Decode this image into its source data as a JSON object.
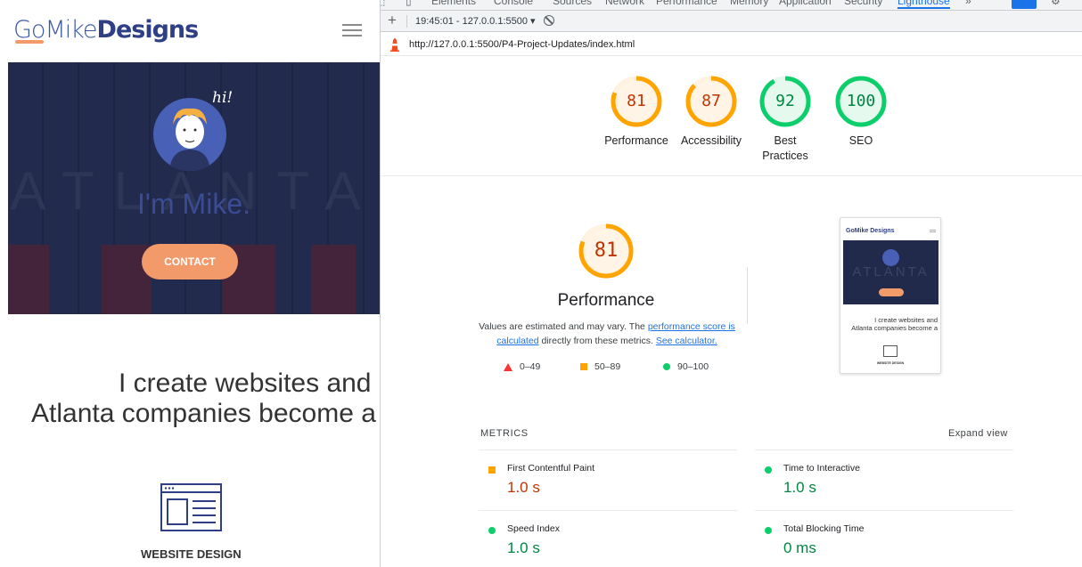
{
  "site": {
    "logo_part1": "GoMike",
    "logo_part2": "Designs",
    "hero_greeting": "hi!",
    "hero_heading": "I'm Mike.",
    "hero_wall_text": "ATLANTA",
    "contact_button": "CONTACT",
    "tagline_line1": "I create websites and",
    "tagline_line2": "Atlanta companies become a",
    "service_label": "WEBSITE DESIGN",
    "accent_color": "#f39a6b"
  },
  "devtools": {
    "tabs": [
      "Elements",
      "Console",
      "Sources",
      "Network",
      "Performance",
      "Memory",
      "Application",
      "Security",
      "Lighthouse",
      "»"
    ],
    "active_tab": "Lighthouse",
    "report_selector": "19:45:01 - 127.0.0.1:5500 ▾",
    "url": "http://127.0.0.1:5500/P4-Project-Updates/index.html",
    "summary": [
      {
        "label_line1": "Performance",
        "label_line2": "",
        "score": "81",
        "score_fraction": 0.81,
        "rating": "average"
      },
      {
        "label_line1": "Accessibility",
        "label_line2": "",
        "score": "87",
        "score_fraction": 0.87,
        "rating": "average"
      },
      {
        "label_line1": "Best",
        "label_line2": "Practices",
        "score": "92",
        "score_fraction": 0.92,
        "rating": "pass"
      },
      {
        "label_line1": "SEO",
        "label_line2": "",
        "score": "100",
        "score_fraction": 1.0,
        "rating": "pass"
      }
    ],
    "performance": {
      "score": "81",
      "score_fraction": 0.81,
      "title": "Performance",
      "desc_before": "Values are estimated and may vary. The ",
      "desc_link1": "performance score is calculated",
      "desc_middle": " directly from these metrics. ",
      "desc_link2": "See calculator.",
      "legend": [
        {
          "icon": "fail-triangle-icon",
          "range": "0–49"
        },
        {
          "icon": "average-square-icon",
          "range": "50–89"
        },
        {
          "icon": "pass-circle-icon",
          "range": "90–100"
        }
      ]
    },
    "screenshot_thumb": {
      "logo": "GoMike Designs",
      "hero_text": "ATLANTA",
      "text_line1": "I create websites and",
      "text_line2": "Atlanta companies become a",
      "service": "WEBSITE DESIGN"
    },
    "metrics_header": "METRICS",
    "expand_label": "Expand view",
    "metrics": [
      {
        "name": "First Contentful Paint",
        "value": "1.0 s",
        "rating": "average"
      },
      {
        "name": "Time to Interactive",
        "value": "1.0 s",
        "rating": "pass"
      },
      {
        "name": "Speed Index",
        "value": "1.0 s",
        "rating": "pass"
      },
      {
        "name": "Total Blocking Time",
        "value": "0 ms",
        "rating": "pass"
      }
    ],
    "colors": {
      "average": "#ffa400",
      "average_text": "#c33300",
      "pass": "#0cce6b",
      "pass_text": "#018642",
      "fail": "#ff3333",
      "link": "#1a73e8"
    }
  }
}
